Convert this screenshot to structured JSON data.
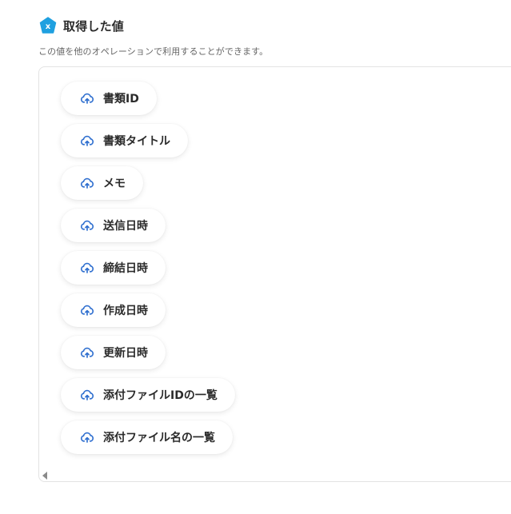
{
  "section": {
    "title": "取得した値",
    "badge_letter": "x",
    "badge_color": "#1fa0e0",
    "description": "この値を他のオペレーションで利用することができます。"
  },
  "values": [
    {
      "label": "書類ID",
      "icon": "cloud-upload-icon"
    },
    {
      "label": "書類タイトル",
      "icon": "cloud-upload-icon"
    },
    {
      "label": "メモ",
      "icon": "cloud-upload-icon"
    },
    {
      "label": "送信日時",
      "icon": "cloud-upload-icon"
    },
    {
      "label": "締結日時",
      "icon": "cloud-upload-icon"
    },
    {
      "label": "作成日時",
      "icon": "cloud-upload-icon"
    },
    {
      "label": "更新日時",
      "icon": "cloud-upload-icon"
    },
    {
      "label": "添付ファイルIDの一覧",
      "icon": "cloud-upload-icon"
    },
    {
      "label": "添付ファイル名の一覧",
      "icon": "cloud-upload-icon"
    }
  ],
  "colors": {
    "icon": "#2f6fcf",
    "border": "#e3e3e3"
  }
}
